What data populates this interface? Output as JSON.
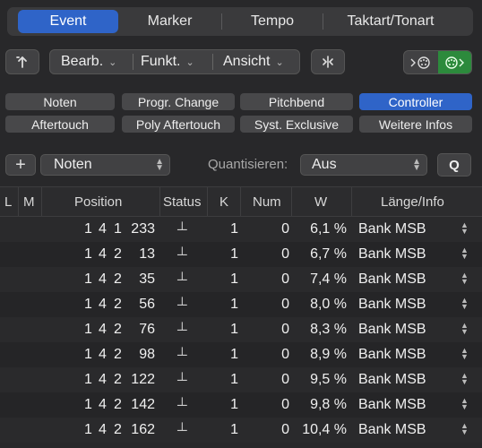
{
  "tabs": [
    "Event",
    "Marker",
    "Tempo",
    "Taktart/Tonart"
  ],
  "toolbar": {
    "menus": [
      "Bearb.",
      "Funkt.",
      "Ansicht"
    ]
  },
  "filters": {
    "row1": [
      "Noten",
      "Progr. Change",
      "Pitchbend",
      "Controller"
    ],
    "row2": [
      "Aftertouch",
      "Poly Aftertouch",
      "Syst. Exclusive",
      "Weitere Infos"
    ],
    "selected": "Controller"
  },
  "create": {
    "add_symbol": "+",
    "type_value": "Noten",
    "quantize_label": "Quantisieren:",
    "quantize_value": "Aus",
    "q_button": "Q"
  },
  "table": {
    "headers": [
      "L",
      "M",
      "Position",
      "Status",
      "K",
      "Num",
      "W",
      "Länge/Info"
    ],
    "rows": [
      {
        "bar": "1",
        "beat": "4",
        "div": "1",
        "tick": "233",
        "status": "┴",
        "ch": "1",
        "num": "0",
        "val": "6,1 %",
        "info": "Bank MSB"
      },
      {
        "bar": "1",
        "beat": "4",
        "div": "2",
        "tick": "13",
        "status": "┴",
        "ch": "1",
        "num": "0",
        "val": "6,7 %",
        "info": "Bank MSB"
      },
      {
        "bar": "1",
        "beat": "4",
        "div": "2",
        "tick": "35",
        "status": "┴",
        "ch": "1",
        "num": "0",
        "val": "7,4 %",
        "info": "Bank MSB"
      },
      {
        "bar": "1",
        "beat": "4",
        "div": "2",
        "tick": "56",
        "status": "┴",
        "ch": "1",
        "num": "0",
        "val": "8,0 %",
        "info": "Bank MSB"
      },
      {
        "bar": "1",
        "beat": "4",
        "div": "2",
        "tick": "76",
        "status": "┴",
        "ch": "1",
        "num": "0",
        "val": "8,3 %",
        "info": "Bank MSB"
      },
      {
        "bar": "1",
        "beat": "4",
        "div": "2",
        "tick": "98",
        "status": "┴",
        "ch": "1",
        "num": "0",
        "val": "8,9 %",
        "info": "Bank MSB"
      },
      {
        "bar": "1",
        "beat": "4",
        "div": "2",
        "tick": "122",
        "status": "┴",
        "ch": "1",
        "num": "0",
        "val": "9,5 %",
        "info": "Bank MSB"
      },
      {
        "bar": "1",
        "beat": "4",
        "div": "2",
        "tick": "142",
        "status": "┴",
        "ch": "1",
        "num": "0",
        "val": "9,8 %",
        "info": "Bank MSB"
      },
      {
        "bar": "1",
        "beat": "4",
        "div": "2",
        "tick": "162",
        "status": "┴",
        "ch": "1",
        "num": "0",
        "val": "10,4 %",
        "info": "Bank MSB"
      }
    ]
  },
  "colors": {
    "accent": "#2f64c8",
    "toggle_on": "#2c8a3c"
  }
}
